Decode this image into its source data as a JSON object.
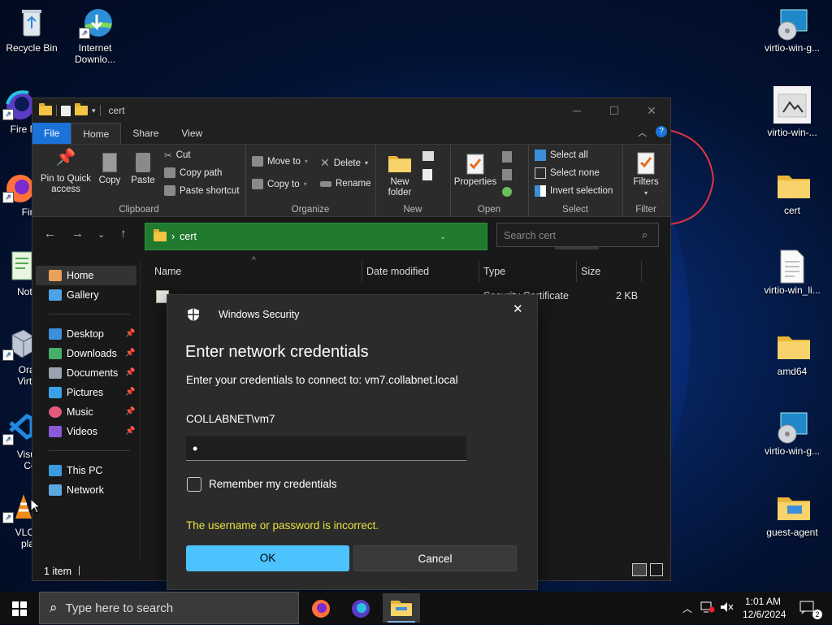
{
  "desktop": {
    "icons_left": [
      {
        "label": "Recycle Bin",
        "icon": "recycle-bin-icon"
      },
      {
        "label": "Internet Downlo...",
        "icon": "internet-download-icon"
      },
      {
        "label": "Fire Nigh",
        "icon": "firefox-nightly-icon"
      },
      {
        "label": "Fire",
        "icon": "firefox-icon"
      },
      {
        "label": "Notep",
        "icon": "notepad-icon"
      },
      {
        "label": "Oracl Virtua",
        "icon": "virtualbox-icon"
      },
      {
        "label": "Visual Co",
        "icon": "vscode-icon"
      },
      {
        "label": "VLC m play",
        "icon": "vlc-icon"
      }
    ],
    "icons_right": [
      {
        "label": "virtio-win-g...",
        "icon": "installer-icon"
      },
      {
        "label": "virtio-win-...",
        "icon": "image-file-icon"
      },
      {
        "label": "cert",
        "icon": "folder-icon"
      },
      {
        "label": "virtio-win_li...",
        "icon": "text-file-icon"
      },
      {
        "label": "amd64",
        "icon": "folder-icon"
      },
      {
        "label": "virtio-win-g...",
        "icon": "installer-icon"
      },
      {
        "label": "guest-agent",
        "icon": "folder-icon"
      }
    ]
  },
  "explorer": {
    "title": "cert",
    "tabs": {
      "file": "File",
      "home": "Home",
      "share": "Share",
      "view": "View"
    },
    "ribbon": {
      "clipboard": {
        "pin": "Pin to Quick access",
        "copy": "Copy",
        "paste": "Paste",
        "cut": "Cut",
        "copy_path": "Copy path",
        "paste_shortcut": "Paste shortcut",
        "label": "Clipboard"
      },
      "organize": {
        "move_to": "Move to",
        "copy_to": "Copy to",
        "delete": "Delete",
        "rename": "Rename",
        "label": "Organize"
      },
      "new": {
        "new_folder": "New folder",
        "label": "New"
      },
      "open": {
        "properties": "Properties",
        "label": "Open"
      },
      "select": {
        "select_all": "Select all",
        "select_none": "Select none",
        "invert": "Invert selection",
        "label": "Select"
      },
      "filter": {
        "filters": "Filters",
        "label": "Filter"
      }
    },
    "address": {
      "path": "cert",
      "search_placeholder": "Search cert"
    },
    "nav": {
      "home": "Home",
      "gallery": "Gallery",
      "desktop": "Desktop",
      "downloads": "Downloads",
      "documents": "Documents",
      "pictures": "Pictures",
      "music": "Music",
      "videos": "Videos",
      "this_pc": "This PC",
      "network": "Network"
    },
    "columns": {
      "name": "Name",
      "date": "Date modified",
      "type": "Type",
      "size": "Size"
    },
    "row": {
      "type": "Security Certificate",
      "size": "2 KB"
    },
    "status": "1 item"
  },
  "dialog": {
    "title": "Windows Security",
    "heading": "Enter network credentials",
    "message": "Enter your credentials to connect to: vm7.collabnet.local",
    "username": "COLLABNET\\vm7",
    "password_mask": "•",
    "remember": "Remember my credentials",
    "error": "The username or password is incorrect.",
    "ok": "OK",
    "cancel": "Cancel"
  },
  "taskbar": {
    "search_placeholder": "Type here to search",
    "time": "1:01 AM",
    "date": "12/6/2024",
    "notification_count": "2"
  }
}
